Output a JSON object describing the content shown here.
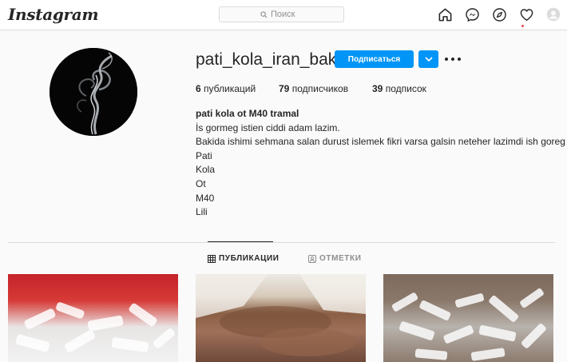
{
  "header": {
    "logo_text": "Instagram",
    "search_placeholder": "Поиск",
    "icons": [
      "home-icon",
      "messenger-icon",
      "explore-icon",
      "activity-heart-icon",
      "profile-avatar-icon"
    ],
    "notification_dot_color": "#ed4956"
  },
  "profile": {
    "username": "pati_kola_iran_baki",
    "follow_label": "Подписаться",
    "stats": {
      "posts_count": "6",
      "posts_label": "публикаций",
      "followers_count": "79",
      "followers_label": "подписчиков",
      "following_count": "39",
      "following_label": "подписок"
    },
    "bio": {
      "name": "pati kola ot M40 tramal",
      "lines": [
        "İs gormeg istien ciddi adam lazim.",
        "Bakida ishimi sehmana salan durust islemek fikri varsa galsin neteher lazimdi ish goreg",
        "Pati",
        "Kola",
        "Ot",
        "M40",
        "Lili"
      ]
    },
    "accent_color": "#0095f6"
  },
  "tabs": {
    "posts_label": "ПУБЛИКАЦИИ",
    "tagged_label": "ОТМЕТКИ"
  }
}
